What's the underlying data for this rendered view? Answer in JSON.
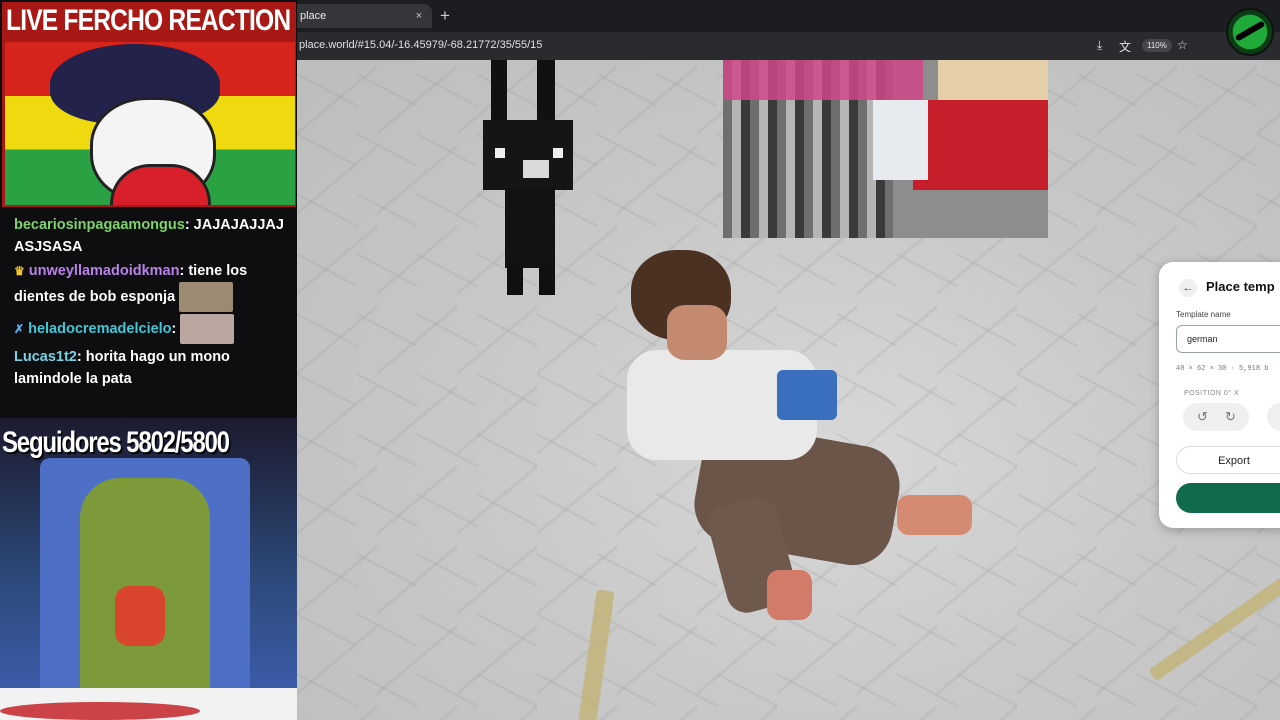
{
  "browser": {
    "tab_title": "place",
    "tab_close": "×",
    "new_tab": "+",
    "url": "place.world/#15.04/-16.45979/-68.21772/35/55/15",
    "zoom": "110%"
  },
  "panel": {
    "back": "←",
    "title": "Place temp",
    "template_label": "Template name",
    "template_value": "german",
    "dims": "40 × 62 × 30 · 5,918 b",
    "position_label": "POSITION   0° X",
    "rotate_left": "↺",
    "rotate_right": "↻",
    "export_label": "Export"
  },
  "overlay": {
    "banner_title": "LIVE FERCHO REACTION",
    "chat": [
      {
        "user": "becariosinpagaamongus",
        "text": ": JAJAJAJJAJ ASJSASA"
      },
      {
        "badge": "♛",
        "user": "unweyllamadoidkman",
        "text": ": tiene los dientes de bob esponja"
      },
      {
        "badge": "✗",
        "user": "heladocremadelcielo",
        "text": ":"
      },
      {
        "user": "Lucas1t2",
        "text": ": horita hago un mono lamindole la pata"
      }
    ],
    "followers": "Seguidores 5802/5800"
  }
}
